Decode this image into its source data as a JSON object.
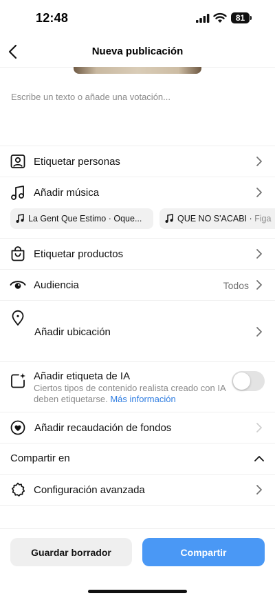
{
  "status_bar": {
    "time": "12:48",
    "battery": "81"
  },
  "header": {
    "title": "Nueva publicación"
  },
  "caption": {
    "placeholder": "Escribe un texto o añade una votación..."
  },
  "rows": {
    "tag_people": {
      "label": "Etiquetar personas"
    },
    "add_music": {
      "label": "Añadir música"
    },
    "tag_products": {
      "label": "Etiquetar productos"
    },
    "audience": {
      "label": "Audiencia",
      "value": "Todos"
    },
    "location": {
      "label": "Añadir ubicación"
    },
    "ai_label": {
      "label": "Añadir etiqueta de IA",
      "description": "Ciertos tipos de contenido realista creado con IA deben etiquetarse.",
      "link": "Más información",
      "enabled": false
    },
    "fundraiser": {
      "label": "Añadir recaudación de fondos"
    },
    "advanced": {
      "label": "Configuración avanzada"
    }
  },
  "music_suggestions": [
    {
      "title": "La Gent Que Estimo",
      "artist": "Oque..."
    },
    {
      "title": "QUE NO S'ACABI",
      "artist": "Figa"
    }
  ],
  "share_section": {
    "label": "Compartir en"
  },
  "footer": {
    "draft_label": "Guardar borrador",
    "share_label": "Compartir"
  },
  "colors": {
    "accent": "#4a98f5",
    "link": "#2f7de1",
    "muted_text": "#8a8a8a"
  }
}
